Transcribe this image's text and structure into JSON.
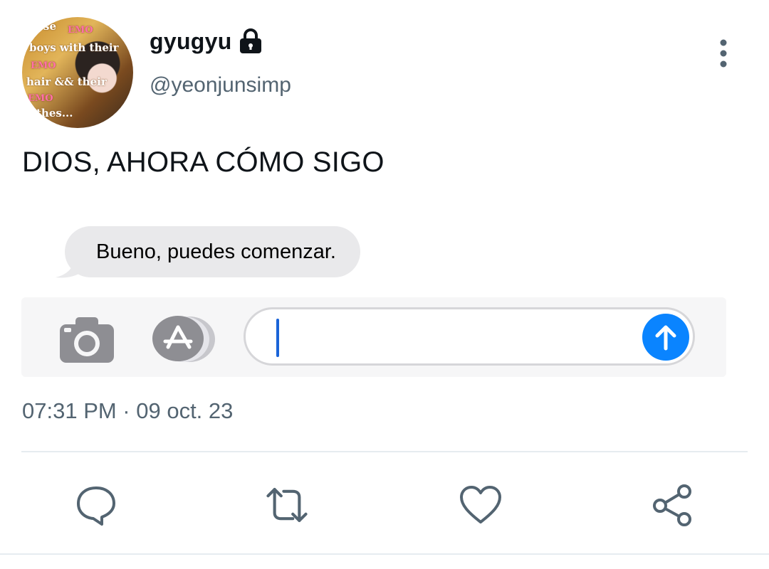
{
  "author": {
    "display_name": "gyugyu",
    "handle": "@yeonjunsimp",
    "protected_icon": "lock-icon",
    "avatar_text": [
      "se",
      "EMO",
      "boys with their",
      "EMO",
      "hair && their",
      "EMO",
      "othes..."
    ]
  },
  "tweet": {
    "text": "DIOS, AHORA CÓMO SIGO",
    "timestamp": "07:31 PM · 09 oct. 23"
  },
  "media": {
    "message_bubble": "Bueno, puedes comenzar.",
    "composer_icons": [
      "camera-icon",
      "app-store-icon"
    ],
    "send_icon": "arrow-up-icon"
  },
  "actions": [
    "reply-icon",
    "retweet-icon",
    "like-icon",
    "share-icon"
  ],
  "colors": {
    "secondary_text": "#536471",
    "imessage_blue": "#0a84ff",
    "bubble_gray": "#e9e9eb",
    "icon_gray": "#536471"
  }
}
